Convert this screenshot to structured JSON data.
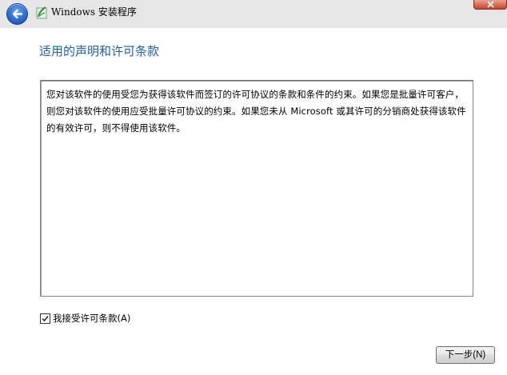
{
  "titlebar": {
    "title": "Windows 安装程序",
    "back_icon": "back-arrow-icon",
    "app_icon": "windows-setup-icon",
    "close_icon": "close-icon",
    "colors": {
      "back_button": "#2d6bd0",
      "close_button": "#c7432a",
      "background": "#e6e6e6"
    }
  },
  "main": {
    "title": "适用的声明和许可条款",
    "title_color": "#1e5fa8",
    "license_text": "您对该软件的使用受您为获得该软件而签订的许可协议的条款和条件的约束。如果您是批量许可客户，则您对该软件的使用应受批量许可协议的约束。如果您未从 Microsoft 或其许可的分销商处获得该软件的有效许可，则不得使用该软件。",
    "accept_checkbox": {
      "label": "我接受许可条款(A)",
      "checked": true
    },
    "next_button": {
      "label": "下一步(N)"
    }
  }
}
